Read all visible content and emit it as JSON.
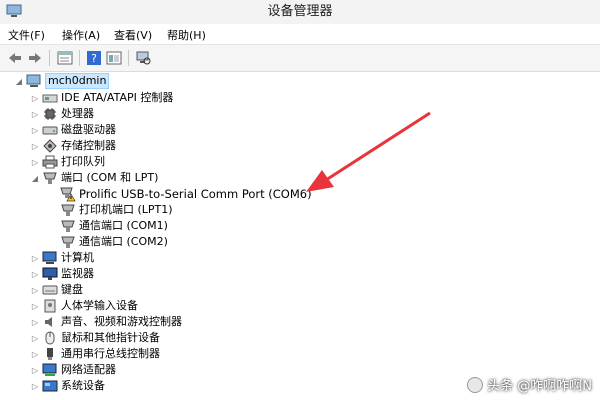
{
  "window": {
    "title": "设备管理器"
  },
  "menu": [
    "文件(F)",
    "操作(A)",
    "查看(V)",
    "帮助(H)"
  ],
  "toolbar": {
    "buttons": [
      "back-icon",
      "forward-icon",
      "properties-icon",
      "help-icon",
      "view-icon",
      "scan-icon"
    ]
  },
  "tree": {
    "root": "mch0dmin",
    "items": [
      {
        "label": "IDE ATA/ATAPI 控制器",
        "icon": "ide-controller-icon"
      },
      {
        "label": "处理器",
        "icon": "processor-icon"
      },
      {
        "label": "磁盘驱动器",
        "icon": "disk-drive-icon"
      },
      {
        "label": "存储控制器",
        "icon": "storage-controller-icon"
      },
      {
        "label": "打印队列",
        "icon": "printer-icon"
      },
      {
        "label": "端口 (COM 和 LPT)",
        "icon": "port-icon",
        "expanded": true,
        "children": [
          {
            "label": "Prolific USB-to-Serial Comm Port (COM6)",
            "icon": "warning-port-icon"
          },
          {
            "label": "打印机端口 (LPT1)",
            "icon": "port-icon"
          },
          {
            "label": "通信端口 (COM1)",
            "icon": "port-icon"
          },
          {
            "label": "通信端口 (COM2)",
            "icon": "port-icon"
          }
        ]
      },
      {
        "label": "计算机",
        "icon": "computer-icon"
      },
      {
        "label": "监视器",
        "icon": "monitor-icon"
      },
      {
        "label": "键盘",
        "icon": "keyboard-icon"
      },
      {
        "label": "人体学输入设备",
        "icon": "hid-icon"
      },
      {
        "label": "声音、视频和游戏控制器",
        "icon": "audio-icon"
      },
      {
        "label": "鼠标和其他指针设备",
        "icon": "mouse-icon"
      },
      {
        "label": "通用串行总线控制器",
        "icon": "usb-icon"
      },
      {
        "label": "网络适配器",
        "icon": "network-adapter-icon"
      },
      {
        "label": "系统设备",
        "icon": "system-device-icon"
      }
    ]
  },
  "watermark": "头条 @咋啊咋啊N",
  "colors": {
    "arrow": "#e8343a",
    "selection": "#cce8ff"
  }
}
